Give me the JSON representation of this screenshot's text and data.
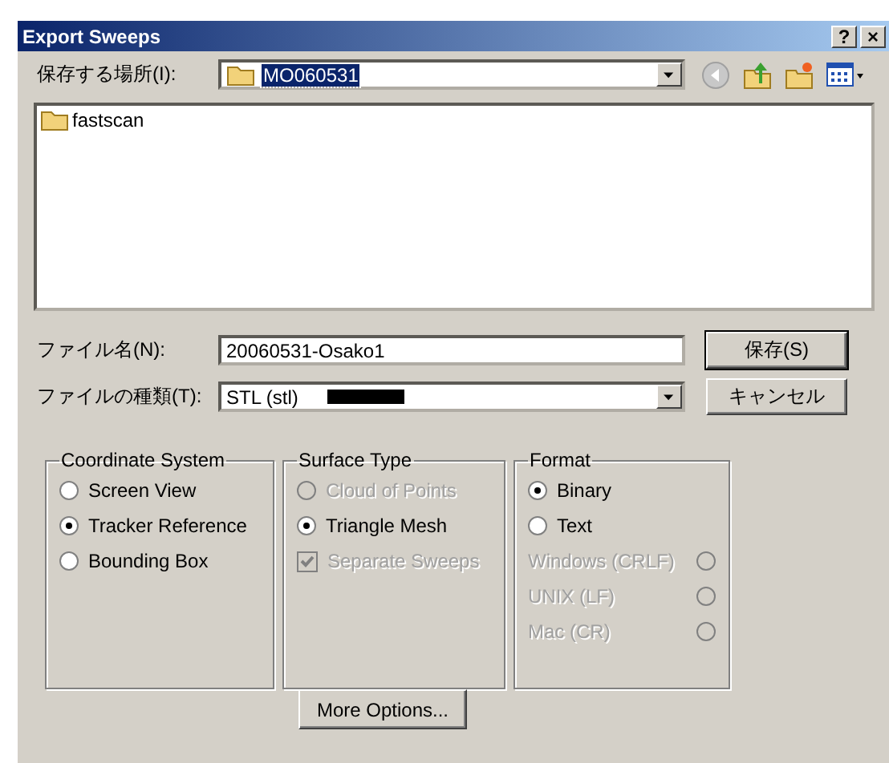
{
  "window": {
    "title": "Export Sweeps",
    "title_buttons": [
      "?",
      "×"
    ]
  },
  "location": {
    "label": "保存する場所(I):",
    "value": "MO060531"
  },
  "files": [
    {
      "name": "fastscan"
    }
  ],
  "filename": {
    "label": "ファイル名(N):",
    "value": "20060531-Osako1"
  },
  "filetype": {
    "label": "ファイルの種類(T):",
    "value": "STL (stl)"
  },
  "buttons": {
    "save": "保存(S)",
    "cancel": "キャンセル",
    "more": "More Options..."
  },
  "groups": [
    {
      "title": "Coordinate System",
      "items": [
        {
          "kind": "radio",
          "label": "Screen View",
          "selected": false,
          "disabled": false
        },
        {
          "kind": "radio",
          "label": "Tracker Reference",
          "selected": true,
          "disabled": false
        },
        {
          "kind": "radio",
          "label": "Bounding Box",
          "selected": false,
          "disabled": false
        }
      ]
    },
    {
      "title": "Surface Type",
      "items": [
        {
          "kind": "radio",
          "label": "Cloud of Points",
          "selected": false,
          "disabled": true
        },
        {
          "kind": "radio",
          "label": "Triangle Mesh",
          "selected": true,
          "disabled": false
        },
        {
          "kind": "checkbox",
          "label": "Separate Sweeps",
          "checked": true,
          "disabled": true
        }
      ]
    },
    {
      "title": "Format",
      "items": [
        {
          "kind": "radio",
          "label": "Binary",
          "selected": true,
          "disabled": false
        },
        {
          "kind": "radio",
          "label": "Text",
          "selected": false,
          "disabled": false
        },
        {
          "kind": "radio-right",
          "label": "Windows (CRLF)",
          "selected": false,
          "disabled": true
        },
        {
          "kind": "radio-right",
          "label": "UNIX (LF)",
          "selected": false,
          "disabled": true
        },
        {
          "kind": "radio-right",
          "label": "Mac (CR)",
          "selected": false,
          "disabled": true
        }
      ]
    }
  ]
}
